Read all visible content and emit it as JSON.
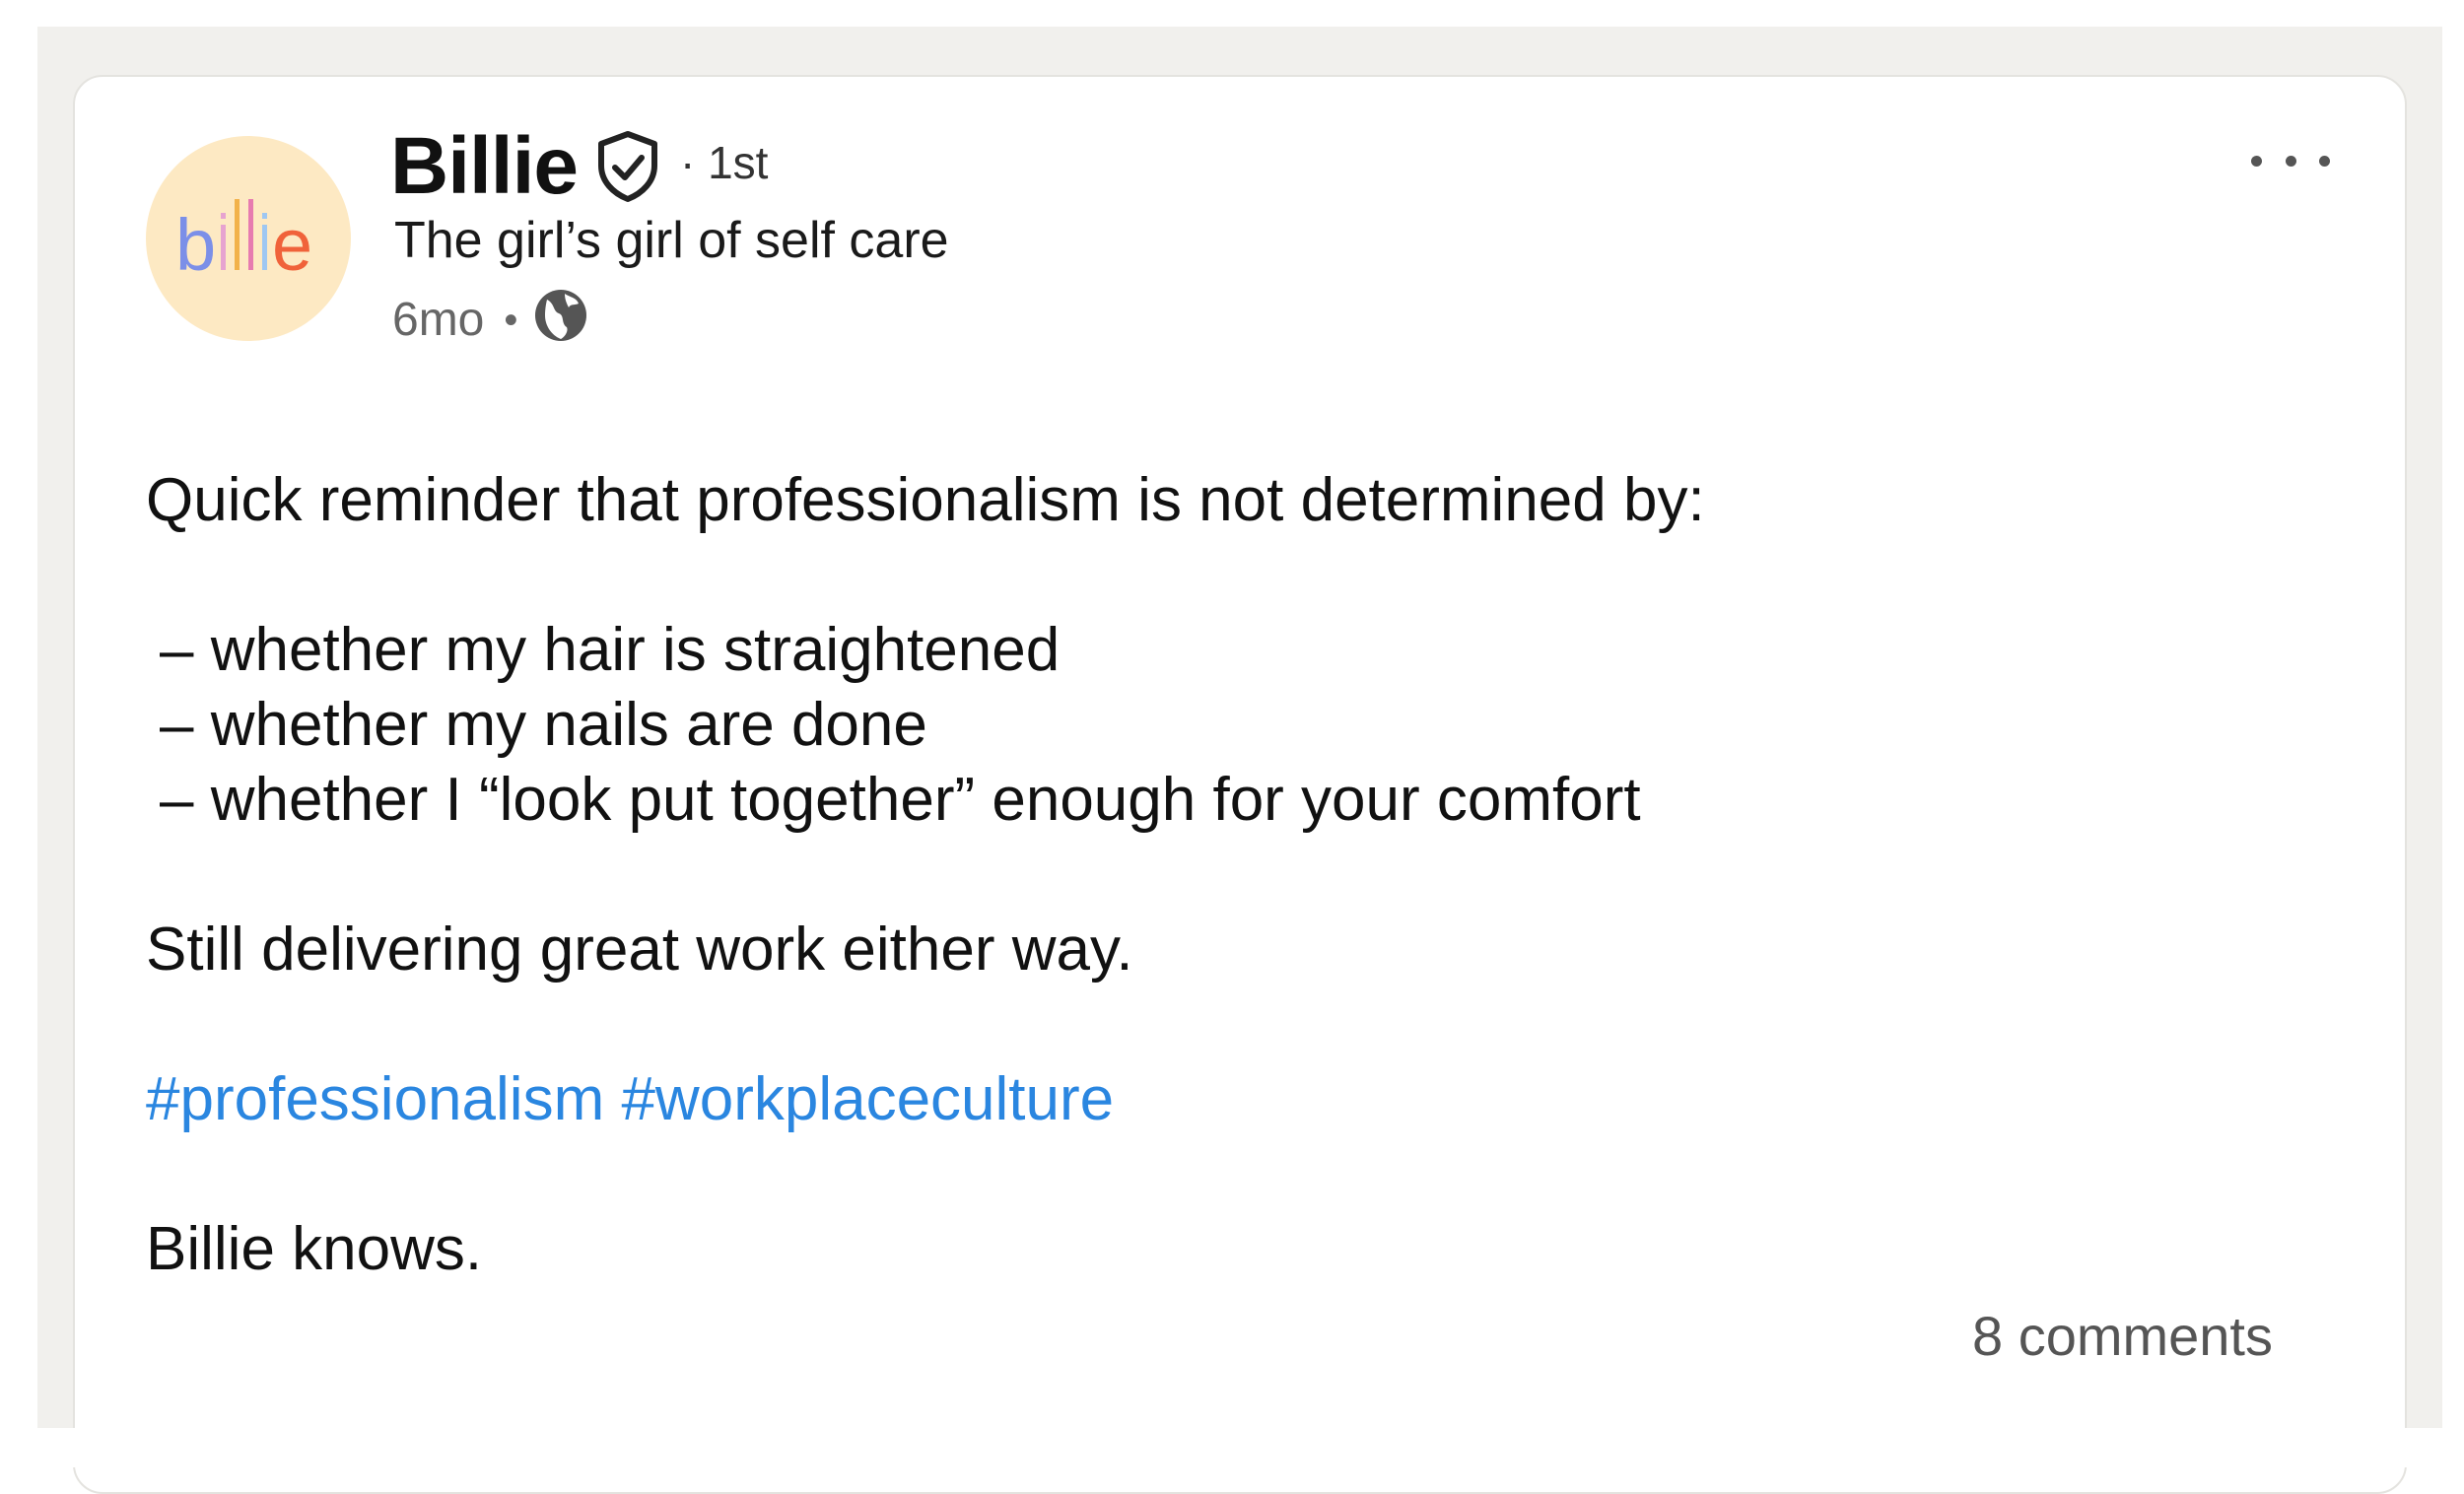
{
  "post": {
    "author": {
      "name": "Billie",
      "connection_degree": "· 1st",
      "headline": "The girl’s girl of self care",
      "avatar_logo_text": "billie",
      "verified_icon": "verified-shield-icon"
    },
    "meta": {
      "time_ago": "6mo",
      "separator": "•",
      "visibility_icon": "globe-icon"
    },
    "more_menu_icon": "ellipsis-icon",
    "body": {
      "intro": "Quick reminder that professionalism is not determined by:",
      "bullets": [
        "– whether my hair is straightened",
        "– whether my nails are done",
        "– whether I “look put together” enough for your comfort"
      ],
      "statement": "Still delivering great work either way.",
      "hashtags": [
        "#professionalism",
        "#workplaceculture"
      ],
      "signoff": "Billie knows."
    },
    "comments_count": "8 comments"
  },
  "colors": {
    "hashtag": "#2a86e0",
    "avatar_bg": "#fde9c3",
    "frame_bg": "#f1f0ed"
  }
}
